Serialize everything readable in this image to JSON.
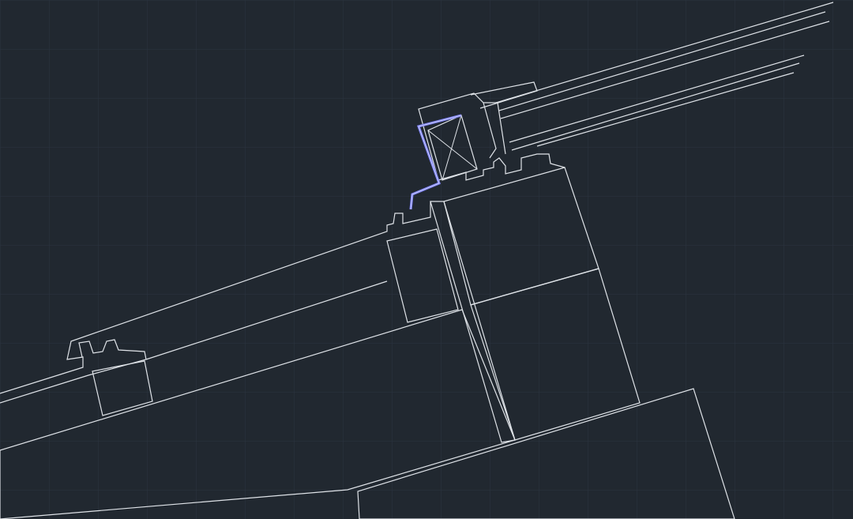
{
  "colors": {
    "background": "#212830",
    "grid": "#2c3440",
    "line": "#dfe3e8",
    "hatch": "#c9cdd3",
    "selected": "#7b7ff0",
    "selected_inner": "#c8ccff"
  },
  "view": {
    "grid": true,
    "selected_entity": "flashing-profile"
  }
}
